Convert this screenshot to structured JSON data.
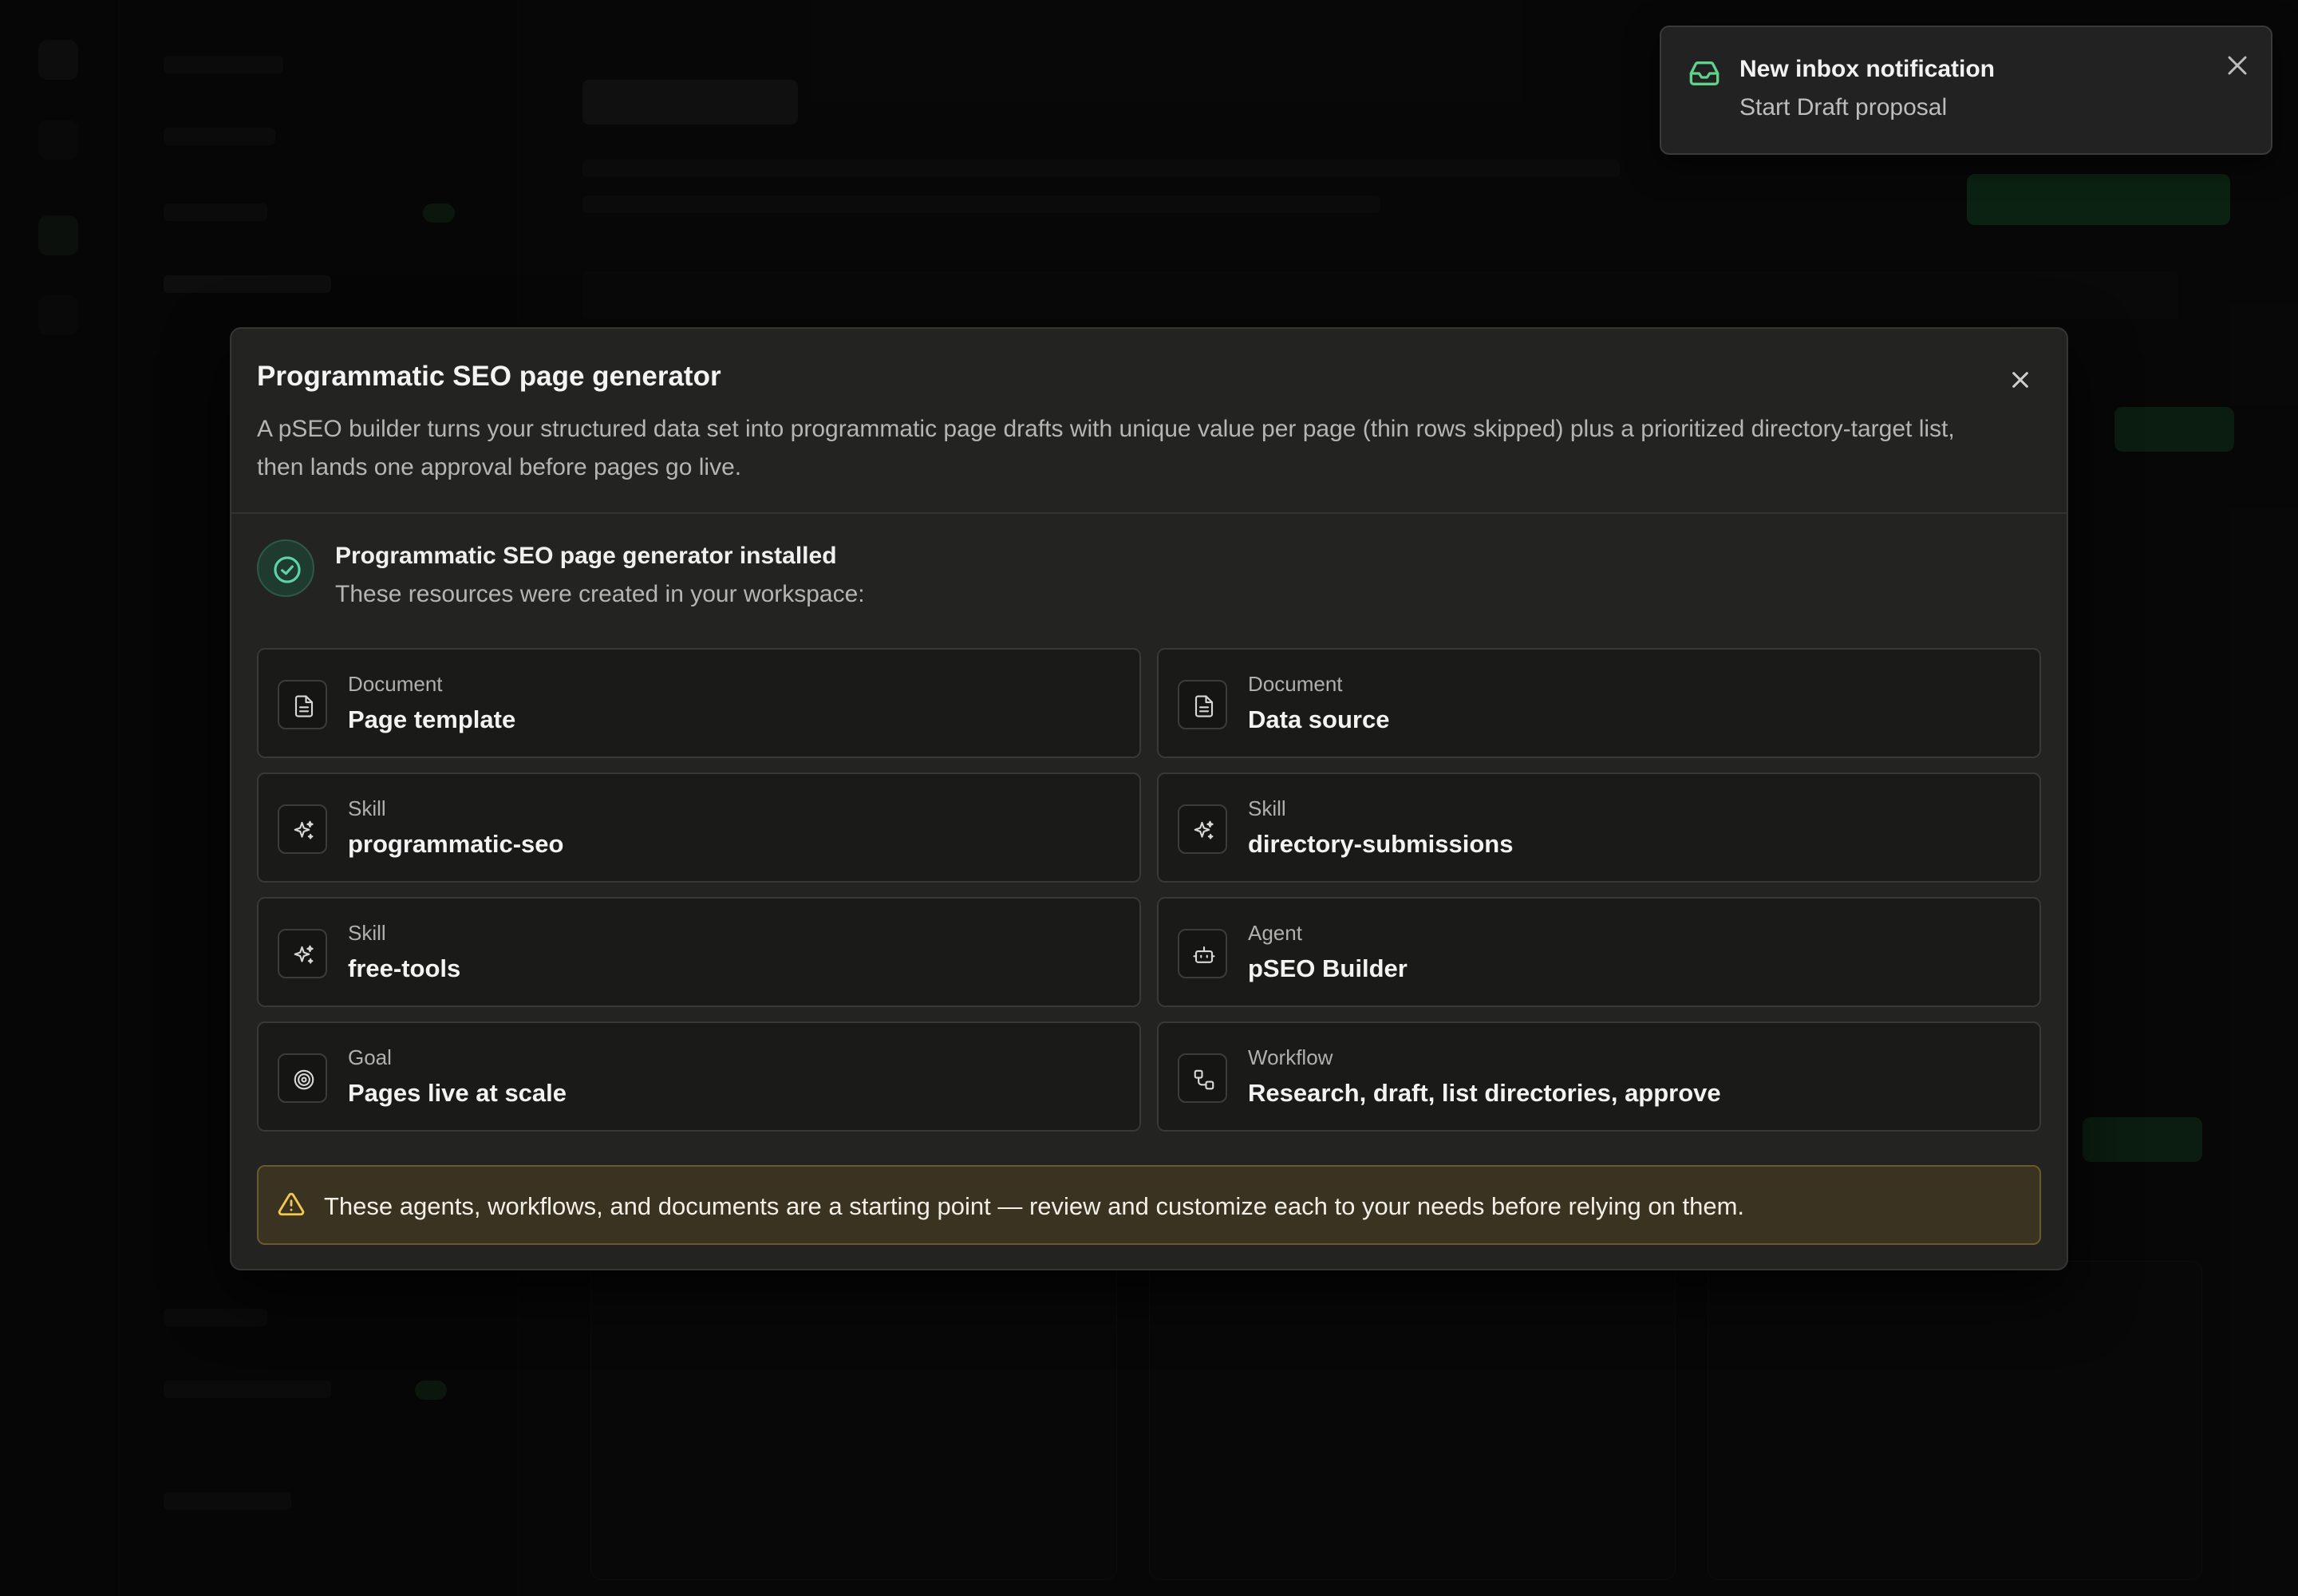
{
  "toast": {
    "title": "New inbox notification",
    "body": "Start Draft proposal",
    "icon": "inbox-icon",
    "accent": "#5fd38a"
  },
  "modal": {
    "title": "Programmatic SEO page generator",
    "description": "A pSEO builder turns your structured data set into programmatic page drafts with unique value per page (thin rows skipped) plus a prioritized directory-target list, then lands one approval before pages go live.",
    "success": {
      "title": "Programmatic SEO page generator installed",
      "subtitle": "These resources were created in your workspace:",
      "icon": "check-circle-icon",
      "color": "#5fd3a8"
    },
    "resources": [
      {
        "type": "Document",
        "name": "Page template",
        "icon": "document-icon"
      },
      {
        "type": "Document",
        "name": "Data source",
        "icon": "document-icon"
      },
      {
        "type": "Skill",
        "name": "programmatic-seo",
        "icon": "sparkle-icon"
      },
      {
        "type": "Skill",
        "name": "directory-submissions",
        "icon": "sparkle-icon"
      },
      {
        "type": "Skill",
        "name": "free-tools",
        "icon": "sparkle-icon"
      },
      {
        "type": "Agent",
        "name": "pSEO Builder",
        "icon": "bot-icon"
      },
      {
        "type": "Goal",
        "name": "Pages live at scale",
        "icon": "target-icon"
      },
      {
        "type": "Workflow",
        "name": "Research, draft, list directories, approve",
        "icon": "workflow-icon"
      }
    ],
    "warning": {
      "text": "These agents, workflows, and documents are a starting point — review and customize each to your needs before relying on them.",
      "icon": "warning-icon",
      "color": "#f2c94c"
    }
  }
}
